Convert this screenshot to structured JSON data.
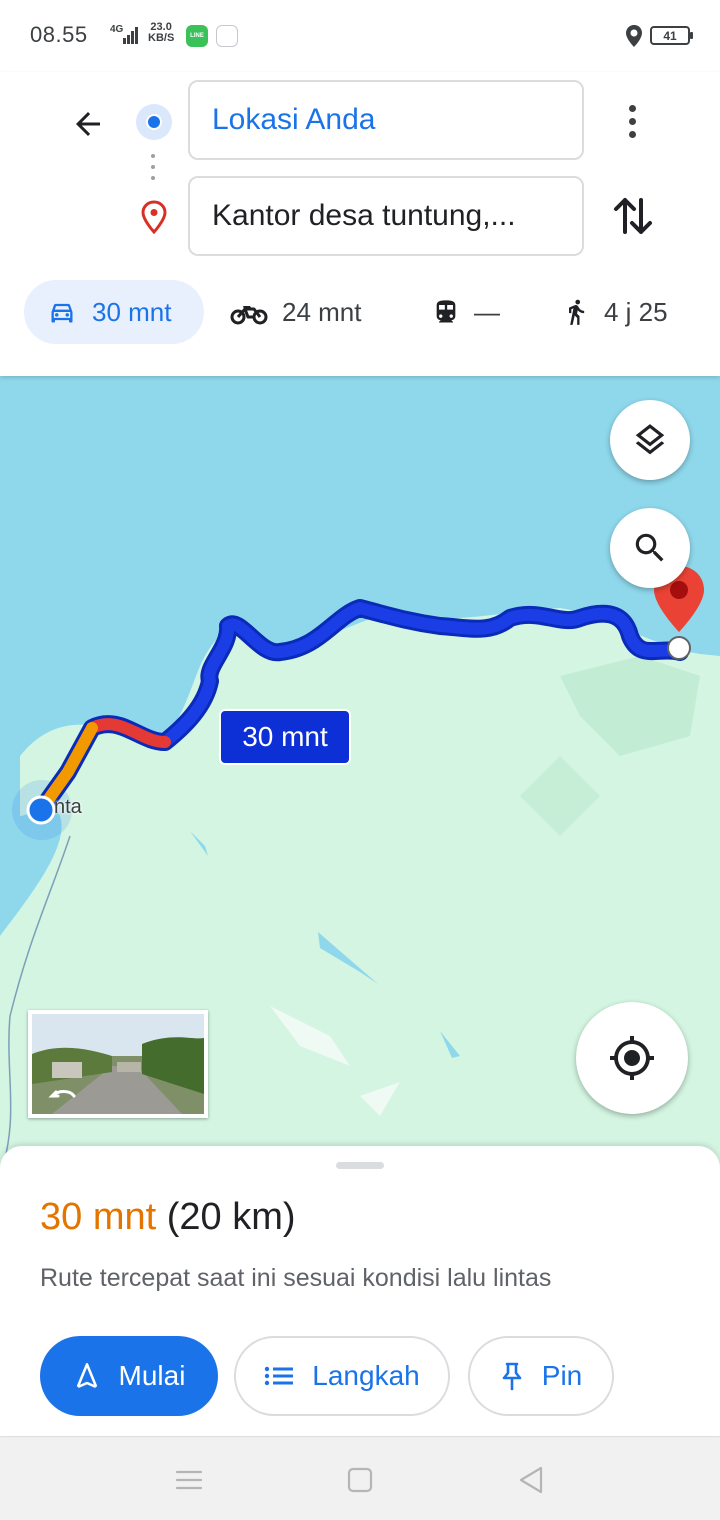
{
  "status_bar": {
    "time": "08.55",
    "network": "4G",
    "speed_value": "23.0",
    "speed_unit": "KB/S",
    "line_icon_text": "LINE",
    "battery": "41"
  },
  "directions": {
    "origin": "Lokasi Anda",
    "destination": "Kantor desa tuntung,..."
  },
  "modes": [
    {
      "name": "car",
      "label": "30 mnt",
      "selected": true
    },
    {
      "name": "motorcycle",
      "label": "24 mnt",
      "selected": false
    },
    {
      "name": "transit",
      "label": "—",
      "selected": false
    },
    {
      "name": "walk",
      "label": "4 j 25",
      "selected": false
    }
  ],
  "map": {
    "route_label": "30 mnt",
    "place_label": "nta",
    "colors": {
      "water": "#8fd8ec",
      "land": "#d3f5e1",
      "route": "#1a3de6",
      "traffic_heavy": "#e53935",
      "traffic_medium": "#f29900",
      "destination_pin": "#ea4335"
    }
  },
  "sheet": {
    "duration": "30 mnt",
    "distance": "(20 km)",
    "description": "Rute tercepat saat ini sesuai kondisi lalu lintas",
    "start_label": "Mulai",
    "steps_label": "Langkah",
    "pin_label": "Pin"
  },
  "icons": [
    "back-arrow-icon",
    "origin-dot-icon",
    "destination-pin-icon",
    "more-vert-icon",
    "swap-icon",
    "car-icon",
    "motorcycle-icon",
    "transit-icon",
    "walk-icon",
    "layers-icon",
    "search-icon",
    "my-location-icon",
    "navigation-icon",
    "list-icon",
    "pin-icon"
  ]
}
